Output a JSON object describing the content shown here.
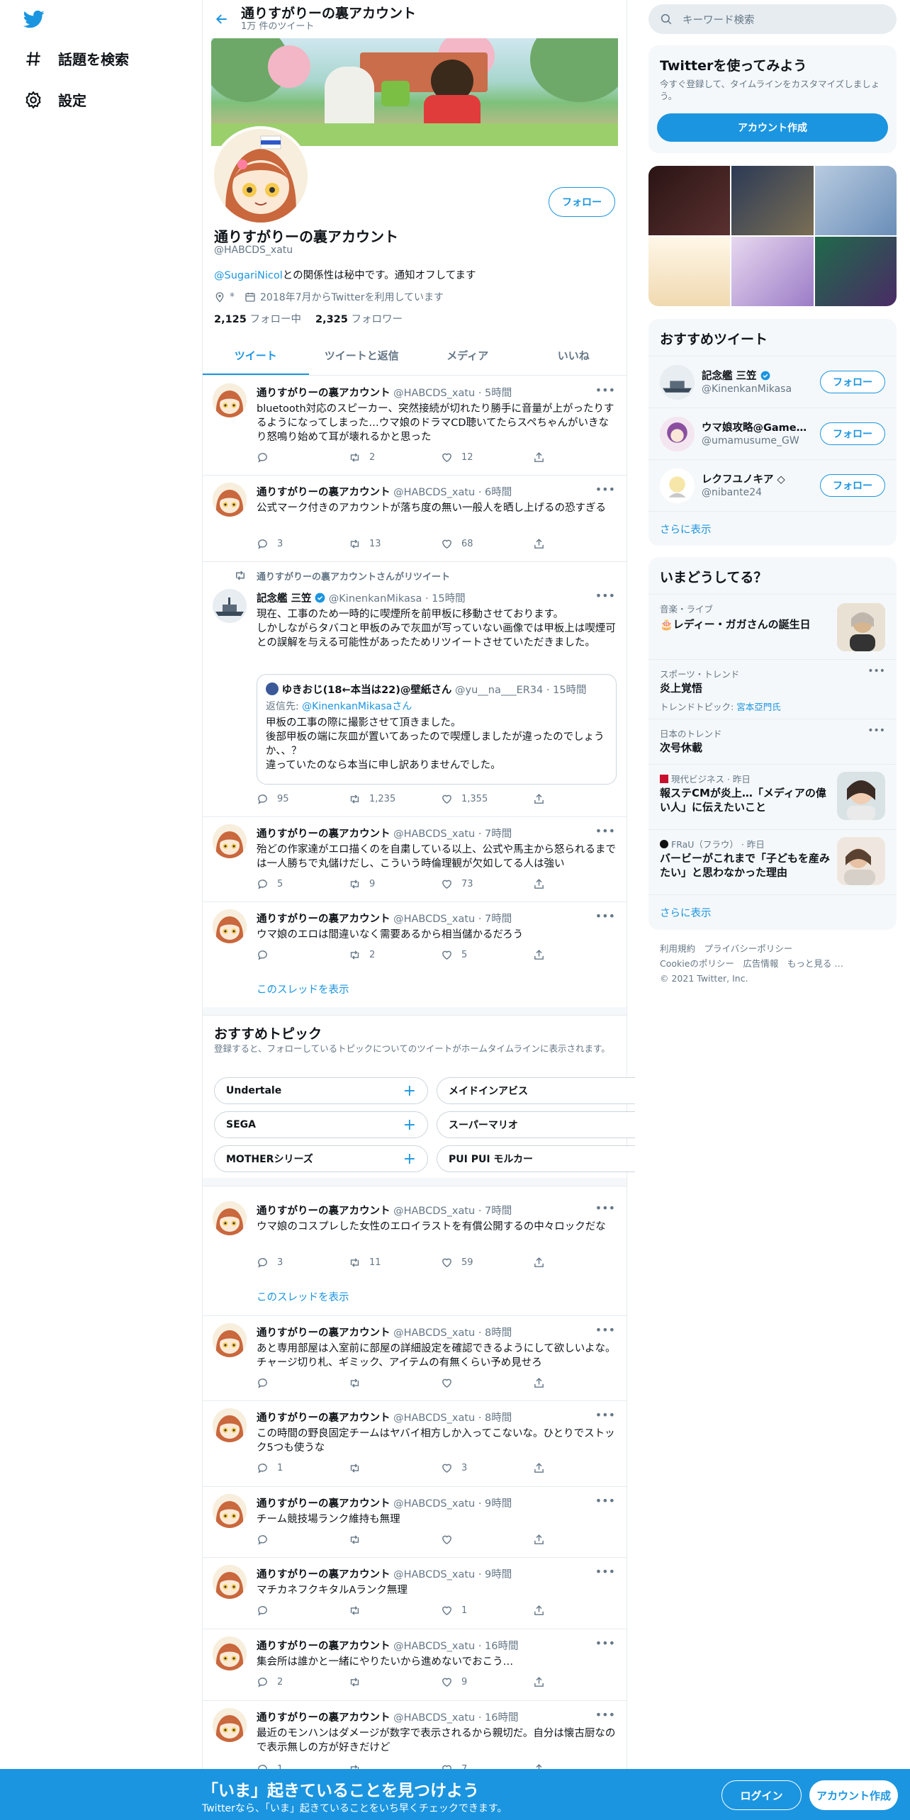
{
  "nav": {
    "explore_label": "話題を検索",
    "settings_label": "設定"
  },
  "header": {
    "title": "通りすがりーの裏アカウント",
    "tweet_count": "1万 件のツイート"
  },
  "profile": {
    "name": "通りすがりーの裏アカウント",
    "handle": "@HABCDS_xatu",
    "bio_mention": "@SugariNicol",
    "bio_text": "との関係性は秘中です。通知オフしてます",
    "location": "*",
    "joined": "2018年7月からTwitterを利用しています",
    "following_count": "2,125",
    "following_label": "フォロー中",
    "followers_count": "2,325",
    "followers_label": "フォロワー",
    "follow_label": "フォロー"
  },
  "tabs": [
    "ツイート",
    "ツイートと返信",
    "メディア",
    "いいね"
  ],
  "tweets": [
    {
      "name": "通りすがりーの裏アカウント",
      "meta": "@HABCDS_xatu · 5時間",
      "text": "bluetooth対応のスピーカー、突然接続が切れたり勝手に音量が上がったりするようになってしまった…ウマ娘のドラマCD聴いてたらスペちゃんがいきなり怒鳴り始めて耳が壊れるかと思った",
      "reply": "",
      "retweet": "2",
      "like": "12"
    },
    {
      "name": "通りすがりーの裏アカウント",
      "meta": "@HABCDS_xatu · 6時間",
      "text": "公式マーク付きのアカウントが落ち度の無い一般人を晒し上げるの恐すぎる",
      "reply": "3",
      "retweet": "13",
      "like": "68"
    },
    {
      "rt_note": "通りすがりーの裏アカウントさんがリツイート",
      "name": "記念艦 三笠",
      "meta": "@KinenkanMikasa · 15時間",
      "text": "現在、工事のため一時的に喫煙所を前甲板に移動させております。\nしかしながらタバコと甲板のみで灰皿が写っていない画像では甲板上は喫煙可との誤解を与える可能性があったためリツイートさせていただきました。",
      "quote_name": "ゆきおじ(18←本当は22)@壁紙さん",
      "quote_meta": "@yu__na___ER34 · 15時間",
      "quote_reply_to_label": "返信先: ",
      "quote_reply_to": "@KinenkanMikasaさん",
      "quote_text": "甲板の工事の際に撮影させて頂きました。\n後部甲板の端に灰皿が置いてあったので喫煙しましたが違ったのでしょうか、、？\n違っていたのなら本当に申し訳ありませんでした。",
      "reply": "95",
      "retweet": "1,235",
      "like": "1,355"
    },
    {
      "name": "通りすがりーの裏アカウント",
      "meta": "@HABCDS_xatu · 7時間",
      "text": "殆どの作家達がエロ描くのを自粛している以上、公式や馬主から怒られるまでは一人勝ちで丸儲けだし、こういう時倫理観が欠如してる人は強い",
      "reply": "5",
      "retweet": "9",
      "like": "73"
    },
    {
      "name": "通りすがりーの裏アカウント",
      "meta": "@HABCDS_xatu · 7時間",
      "text": "ウマ娘のエロは間違いなく需要あるから相当儲かるだろう",
      "reply": "",
      "retweet": "2",
      "like": "5",
      "thread": "このスレッドを表示"
    },
    {
      "name": "通りすがりーの裏アカウント",
      "meta": "@HABCDS_xatu · 7時間",
      "text": "ウマ娘のコスプレした女性のエロイラストを有償公開するの中々ロックだな",
      "reply": "3",
      "retweet": "11",
      "like": "59",
      "thread": "このスレッドを表示"
    },
    {
      "name": "通りすがりーの裏アカウント",
      "meta": "@HABCDS_xatu · 8時間",
      "text": "あと専用部屋は入室前に部屋の詳細設定を確認できるようにして欲しいよな。チャージ切り札、ギミック、アイテムの有無くらい予め見せろ",
      "reply": "",
      "retweet": "",
      "like": ""
    },
    {
      "name": "通りすがりーの裏アカウント",
      "meta": "@HABCDS_xatu · 8時間",
      "text": "この時間の野良固定チームはヤバイ相方しか入ってこないな。ひとりでストック5つも使うな",
      "reply": "1",
      "retweet": "",
      "like": "3"
    },
    {
      "name": "通りすがりーの裏アカウント",
      "meta": "@HABCDS_xatu · 9時間",
      "text": "チーム競技場ランク維持も無理",
      "reply": "",
      "retweet": "",
      "like": ""
    },
    {
      "name": "通りすがりーの裏アカウント",
      "meta": "@HABCDS_xatu · 9時間",
      "text": "マチカネフクキタルAランク無理",
      "reply": "",
      "retweet": "",
      "like": "1"
    },
    {
      "name": "通りすがりーの裏アカウント",
      "meta": "@HABCDS_xatu · 16時間",
      "text": "集会所は誰かと一緒にやりたいから進めないでおこう…",
      "reply": "2",
      "retweet": "",
      "like": "9"
    },
    {
      "name": "通りすがりーの裏アカウント",
      "meta": "@HABCDS_xatu · 16時間",
      "text": "最近のモンハンはダメージが数字で表示されるから親切だ。自分は懐古厨なので表示無しの方が好きだけど",
      "reply": "1",
      "retweet": "",
      "like": "7"
    }
  ],
  "topics": {
    "title": "おすすめトピック",
    "subtitle": "登録すると、フォローしているトピックについてのツイートがホームタイムラインに表示されます。",
    "chips": [
      "Undertale",
      "メイドインアビス",
      "SEGA",
      "スーパーマリオ",
      "MOTHERシリーズ",
      "PUI PUI モルカー"
    ]
  },
  "right": {
    "search_placeholder": "キーワード検索",
    "signup_card": {
      "title": "Twitterを使ってみよう",
      "subtitle": "今すぐ登録して、タイムラインをカスタマイズしましょう。",
      "button": "アカウント作成"
    },
    "recommended": {
      "title": "おすすめツイート",
      "users": [
        {
          "name": "記念艦 三笠",
          "handle": "@KinenkanMikasa",
          "button": "フォロー"
        },
        {
          "name": "ウマ娘攻略@Game...",
          "handle": "@umamusume_GW",
          "button": "フォロー"
        },
        {
          "name": "レクフユノキア ◇",
          "handle": "@nibante24",
          "button": "フォロー"
        }
      ],
      "more": "さらに表示"
    },
    "trends": {
      "title": "いまどうしてる？",
      "items": [
        {
          "category": "音楽・ライブ",
          "title": "🎂レディー・ガガさんの誕生日",
          "extra": ""
        },
        {
          "category": "スポーツ・トレンド",
          "title": "炎上覚悟",
          "extra_label": "トレンドトピック: ",
          "extra": "宮本亞門氏"
        },
        {
          "category": "日本のトレンド",
          "title": "次号休載",
          "extra": ""
        },
        {
          "category": "現代ビジネス · 昨日",
          "title": "報ステCMが炎上…「メディアの偉い人」に伝えたいこと",
          "extra": ""
        },
        {
          "category": "FRaU（フラウ） · 昨日",
          "title": "バービーがこれまで「子どもを産みたい」と思わなかった理由",
          "extra": ""
        }
      ],
      "more": "さらに表示"
    },
    "footer": {
      "line1": "利用規約　プライバシーポリシー",
      "line2": "Cookieのポリシー　広告情報　もっと見る …",
      "line3": "© 2021 Twitter, Inc."
    }
  },
  "bottom_bar": {
    "headline": "「いま」起きていることを見つけよう",
    "sub": "Twitterなら、「いま」起きていることをいち早くチェックできます。",
    "login": "ログイン",
    "signup": "アカウント作成"
  },
  "colors": {
    "accent": "#1b95e0",
    "muted": "#657786",
    "border": "#e6ecf0"
  }
}
